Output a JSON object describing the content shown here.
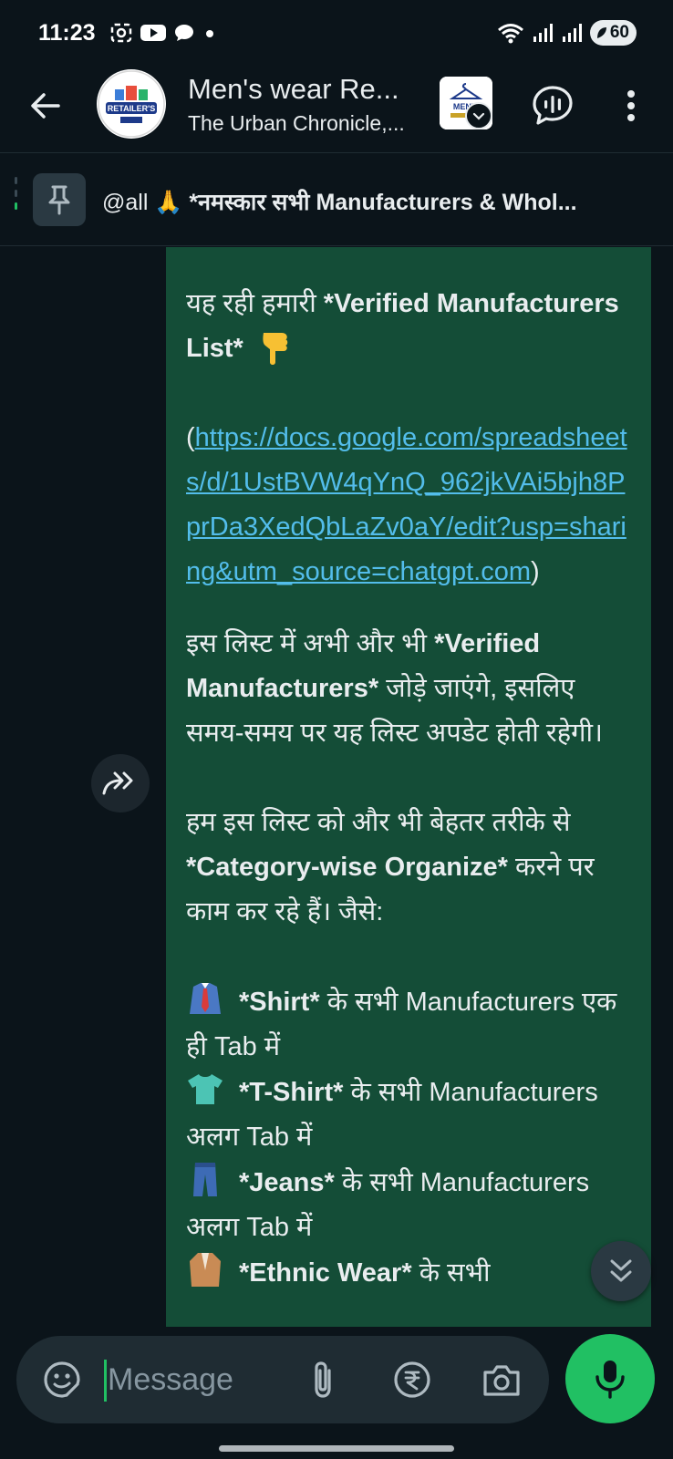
{
  "status_bar": {
    "time": "11:23",
    "battery": "60",
    "icons": [
      "screenshot-icon",
      "youtube-icon",
      "chat-bubble-icon",
      "dot-icon",
      "wifi-icon",
      "signal-icon",
      "signal-icon"
    ]
  },
  "header": {
    "title": "Men's wear Re...",
    "subtitle": "The Urban Chronicle,...",
    "avatar_text": "RETAILER'S",
    "community_avatar_text": "MEN'S"
  },
  "pinned": {
    "prefix": "@all 🙏 ",
    "bold_text": "*नमस्कार सभी Manufacturers & Whol..."
  },
  "message": {
    "intro_plain": "यह रही हमारी ",
    "intro_bold": "*Verified Manufacturers List*",
    "link_open": "(",
    "link": "https://docs.google.com/spreadsheets/d/1UstBVW4qYnQ_962jkVAi5bjh8PprDa3XedQbLaZv0aY/edit?usp=sharing&utm_source=chatgpt.com",
    "link_close": ")",
    "para2_a": "इस लिस्ट में अभी और भी ",
    "para2_bold": "*Verified Manufacturers*",
    "para2_b": " जोड़े जाएंगे, इसलिए समय-समय पर यह लिस्ट अपडेट होती रहेगी।",
    "para3_a": "हम इस लिस्ट को और भी बेहतर तरीके से ",
    "para3_bold": "*Category-wise Organize*",
    "para3_b": " करने पर काम कर रहे हैं। जैसे:",
    "items": [
      {
        "icon": "tie-shirt-emoji",
        "bold": "*Shirt*",
        "text": " के सभी Manufacturers एक ही Tab में"
      },
      {
        "icon": "tshirt-emoji",
        "bold": "*T-Shirt*",
        "text": " के सभी Manufacturers अलग Tab में"
      },
      {
        "icon": "jeans-emoji",
        "bold": "*Jeans*",
        "text": " के सभी Manufacturers अलग Tab में"
      },
      {
        "icon": "coat-emoji",
        "bold": "*Ethnic Wear*",
        "text": " के सभी"
      }
    ]
  },
  "composer": {
    "placeholder": "Message"
  },
  "colors": {
    "background": "#0b141a",
    "bubble": "#144d37",
    "link": "#53bdeb",
    "accent": "#21c063"
  }
}
